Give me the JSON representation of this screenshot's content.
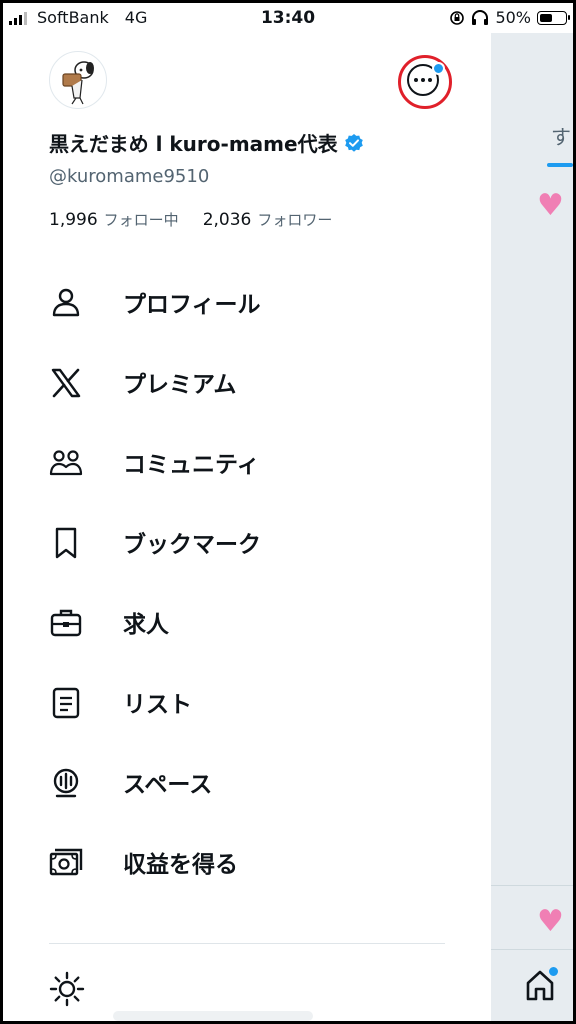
{
  "status_bar": {
    "carrier": "SoftBank",
    "network": "4G",
    "time": "13:40",
    "battery_percent": "50%",
    "battery_level": 0.5,
    "icons": [
      "signal-icon",
      "rotation-lock-icon",
      "headphones-icon",
      "battery-icon"
    ]
  },
  "profile": {
    "display_name": "黒えだまめ l kuro-mame代表",
    "handle": "@kuromame9510",
    "following_count": "1,996",
    "following_label": "フォロー中",
    "followers_count": "2,036",
    "followers_label": "フォロワー",
    "verified": true
  },
  "menu": {
    "items": [
      {
        "label": "プロフィール",
        "icon": "person-icon"
      },
      {
        "label": "プレミアム",
        "icon": "x-logo-icon"
      },
      {
        "label": "コミュニティ",
        "icon": "communities-icon"
      },
      {
        "label": "ブックマーク",
        "icon": "bookmark-icon"
      },
      {
        "label": "求人",
        "icon": "briefcase-icon"
      },
      {
        "label": "リスト",
        "icon": "list-icon"
      },
      {
        "label": "スペース",
        "icon": "spaces-icon"
      },
      {
        "label": "収益を得る",
        "icon": "monetization-icon"
      }
    ]
  },
  "background": {
    "tab_label_partial": "す"
  },
  "colors": {
    "accent": "#1d9bf0",
    "highlight_ring": "#e0202a",
    "heart": "#f07fb4",
    "text_primary": "#0f1419",
    "text_secondary": "#536471"
  }
}
